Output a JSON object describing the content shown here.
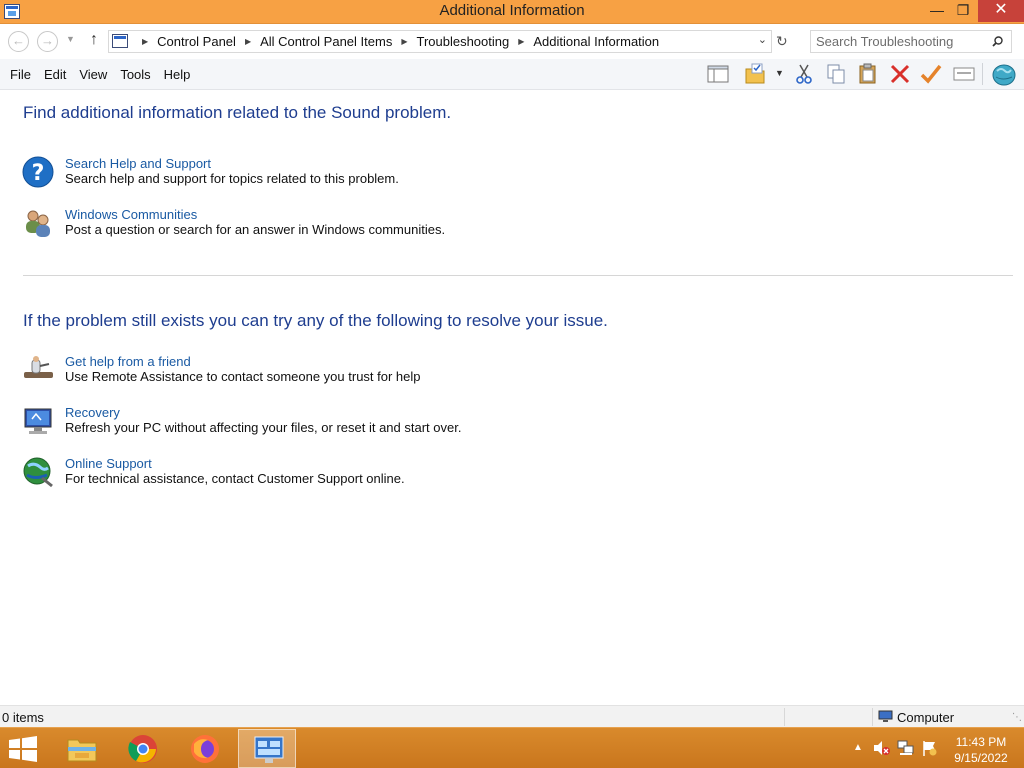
{
  "window": {
    "title": "Additional Information",
    "minimize_glyph": "—",
    "maximize_glyph": "❐",
    "close_glyph": "✕"
  },
  "address": {
    "breadcrumbs": [
      "Control Panel",
      "All Control Panel Items",
      "Troubleshooting",
      "Additional Information"
    ],
    "search_placeholder": "Search Troubleshooting"
  },
  "menu": {
    "file": "File",
    "edit": "Edit",
    "view": "View",
    "tools": "Tools",
    "help": "Help"
  },
  "toolbar_icons": [
    "layout-icon",
    "folder-options-icon",
    "cut-icon",
    "copy-icon",
    "paste-icon",
    "delete-icon",
    "checkmark-icon",
    "properties-icon",
    "globe-icon"
  ],
  "content": {
    "heading_1": "Find additional information related to the Sound problem.",
    "section_1": [
      {
        "icon": "help-question-icon",
        "link": "Search Help and Support",
        "description": "Search help and support for topics related to this problem."
      },
      {
        "icon": "communities-icon",
        "link": "Windows Communities",
        "description": "Post a question or search for an answer in Windows communities."
      }
    ],
    "heading_2": "If the problem still exists you can try any of the following to resolve your issue.",
    "section_2": [
      {
        "icon": "remote-assistance-icon",
        "link": "Get help from a friend",
        "description": "Use Remote Assistance to contact someone you trust for help"
      },
      {
        "icon": "recovery-icon",
        "link": "Recovery",
        "description": "Refresh your PC without affecting your files, or reset it and start over."
      },
      {
        "icon": "online-support-icon",
        "link": "Online Support",
        "description": "For technical assistance, contact Customer Support online."
      }
    ]
  },
  "status": {
    "items_count": "0 items",
    "location": "Computer"
  },
  "taskbar": {
    "apps": [
      "file-explorer",
      "chrome",
      "firefox",
      "control-panel"
    ],
    "clock_time": "11:43 PM",
    "clock_date": "9/15/2022"
  },
  "colors": {
    "title_bar": "#f7a144",
    "taskbar": "#d08028",
    "link": "#1a5aa3",
    "heading": "#1e3d8f"
  }
}
